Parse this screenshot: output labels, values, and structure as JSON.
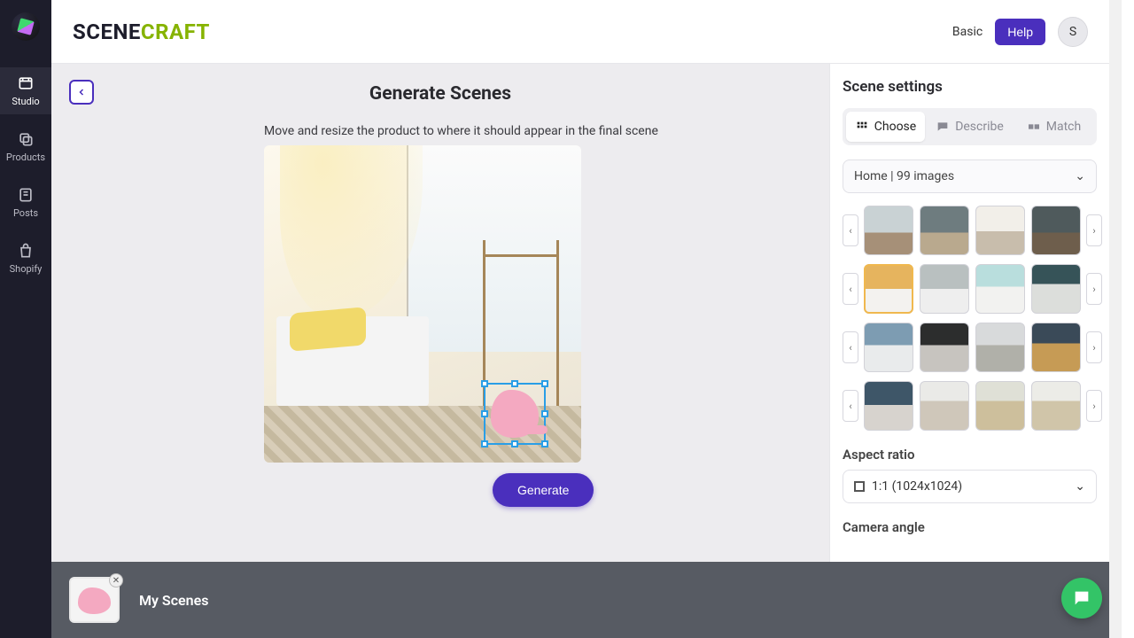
{
  "brand": {
    "part1": "SCENE",
    "part2": "CRAFT"
  },
  "topbar": {
    "plan": "Basic",
    "help": "Help",
    "avatar_initial": "S"
  },
  "rail": {
    "items": [
      {
        "label": "Studio",
        "icon": "film-icon",
        "active": true
      },
      {
        "label": "Products",
        "icon": "stack-icon",
        "active": false
      },
      {
        "label": "Posts",
        "icon": "note-icon",
        "active": false
      },
      {
        "label": "Shopify",
        "icon": "bag-icon",
        "active": false
      }
    ]
  },
  "page": {
    "title": "Generate Scenes",
    "hint": "Move and resize the product to where it should appear in the final scene",
    "generate": "Generate"
  },
  "settings": {
    "heading": "Scene settings",
    "tabs": [
      {
        "label": "Choose",
        "active": true
      },
      {
        "label": "Describe",
        "active": false
      },
      {
        "label": "Match",
        "active": false
      }
    ],
    "library_selected": "Home | 99 images",
    "aspect_label": "Aspect ratio",
    "aspect_value": "1:1 (1024x1024)",
    "camera_label": "Camera angle",
    "thumb_rows": 4,
    "thumbs_per_row": 4,
    "selected_thumb": {
      "row": 1,
      "col": 0
    }
  },
  "bottombar": {
    "title": "My Scenes"
  }
}
